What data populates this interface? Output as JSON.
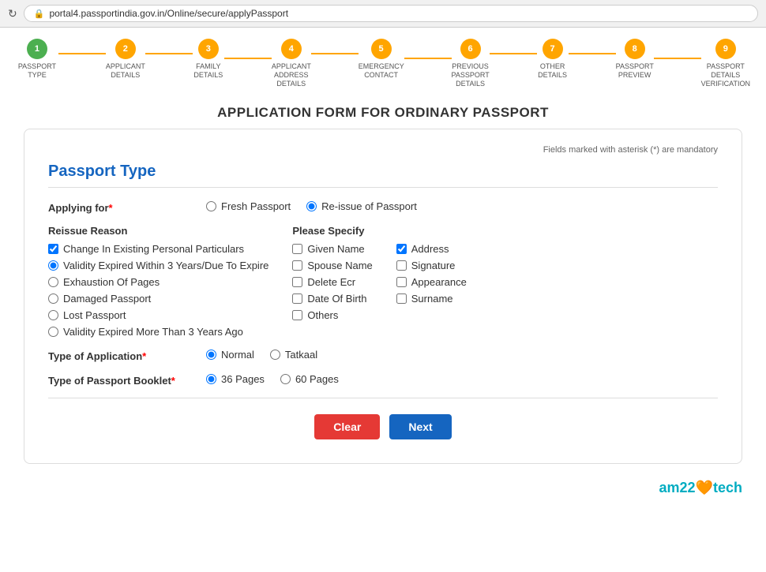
{
  "browser": {
    "url": "portal4.passportindia.gov.in/Online/secure/applyPassport",
    "refresh_icon": "↻"
  },
  "steps": [
    {
      "number": "1",
      "label": "PASSPORT TYPE",
      "state": "active"
    },
    {
      "number": "2",
      "label": "APPLICANT DETAILS",
      "state": "pending"
    },
    {
      "number": "3",
      "label": "FAMILY DETAILS",
      "state": "pending"
    },
    {
      "number": "4",
      "label": "APPLICANT ADDRESS DETAILS",
      "state": "pending"
    },
    {
      "number": "5",
      "label": "EMERGENCY CONTACT",
      "state": "pending"
    },
    {
      "number": "6",
      "label": "PREVIOUS PASSPORT DETAILS",
      "state": "pending"
    },
    {
      "number": "7",
      "label": "OTHER DETAILS",
      "state": "pending"
    },
    {
      "number": "8",
      "label": "PASSPORT PREVIEW",
      "state": "pending"
    },
    {
      "number": "9",
      "label": "PASSPORT DETAILS VERIFICATION",
      "state": "pending"
    }
  ],
  "form": {
    "title": "APPLICATION FORM FOR ORDINARY PASSPORT",
    "mandatory_note": "Fields marked with asterisk (*) are mandatory",
    "section_title": "Passport Type",
    "applying_for_label": "Applying for",
    "applying_for_required": "*",
    "fresh_passport_label": "Fresh Passport",
    "reissue_label": "Re-issue of Passport",
    "reissue_section_heading": "Reissue Reason",
    "please_specify_heading": "Please Specify",
    "reissue_options": [
      {
        "id": "rr1",
        "label": "Change In Existing Personal Particulars",
        "checked": true,
        "type": "checkbox"
      },
      {
        "id": "rr2",
        "label": "Validity Expired Within 3 Years/Due To Expire",
        "checked": true,
        "type": "radio"
      },
      {
        "id": "rr3",
        "label": "Exhaustion Of Pages",
        "checked": false,
        "type": "radio"
      },
      {
        "id": "rr4",
        "label": "Damaged Passport",
        "checked": false,
        "type": "radio"
      },
      {
        "id": "rr5",
        "label": "Lost Passport",
        "checked": false,
        "type": "radio"
      },
      {
        "id": "rr6",
        "label": "Validity Expired More Than 3 Years Ago",
        "checked": false,
        "type": "radio"
      }
    ],
    "specify_col1": [
      {
        "id": "sc1",
        "label": "Given Name",
        "checked": false
      },
      {
        "id": "sc2",
        "label": "Spouse Name",
        "checked": false
      },
      {
        "id": "sc3",
        "label": "Delete Ecr",
        "checked": false
      },
      {
        "id": "sc4",
        "label": "Date Of Birth",
        "checked": false
      },
      {
        "id": "sc5",
        "label": "Others",
        "checked": false
      }
    ],
    "specify_col2": [
      {
        "id": "sd1",
        "label": "Address",
        "checked": true
      },
      {
        "id": "sd2",
        "label": "Signature",
        "checked": false
      },
      {
        "id": "sd3",
        "label": "Appearance",
        "checked": false
      },
      {
        "id": "sd4",
        "label": "Surname",
        "checked": false
      }
    ],
    "type_of_application_label": "Type of Application",
    "type_of_application_required": "*",
    "app_type_options": [
      {
        "id": "ta1",
        "label": "Normal",
        "checked": true
      },
      {
        "id": "ta2",
        "label": "Tatkaal",
        "checked": false
      }
    ],
    "type_of_booklet_label": "Type of Passport Booklet",
    "type_of_booklet_required": "*",
    "booklet_options": [
      {
        "id": "tb1",
        "label": "36 Pages",
        "checked": true
      },
      {
        "id": "tb2",
        "label": "60 Pages",
        "checked": false
      }
    ],
    "clear_button": "Clear",
    "next_button": "Next"
  },
  "branding": {
    "text": "am22tech",
    "heart": "🧡"
  }
}
